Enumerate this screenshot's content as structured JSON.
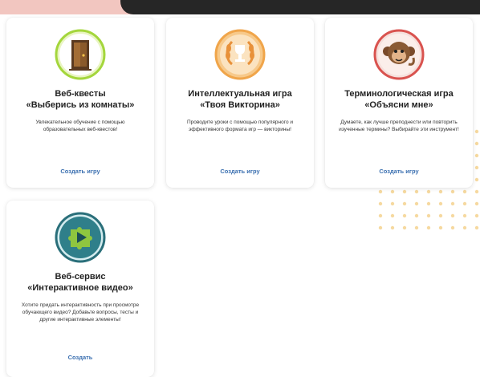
{
  "cards": [
    {
      "icon": "door-icon",
      "title_line1": "Веб-квесты",
      "title_line2": "«Выберись из комнаты»",
      "description": "Увлекательное обучение с помощью образовательных веб-квестов!",
      "link": "Создать игру"
    },
    {
      "icon": "laurel-trophy-icon",
      "title_line1": "Интеллектуальная игра",
      "title_line2": "«Твоя Викторина»",
      "description": "Проводите уроки с помощью популярного и эффективного формата игр — викторины!",
      "link": "Создать игру"
    },
    {
      "icon": "monkey-icon",
      "title_line1": "Терминологическая игра",
      "title_line2": "«Объясни мне»",
      "description": "Думаете, как лучше преподнести или повторить изученные термины? Выбирайте эти инструмент!",
      "link": "Создать игру"
    },
    {
      "icon": "video-puzzle-icon",
      "title_line1": "Веб-сервис",
      "title_line2": "«Интерактивное видео»",
      "description": "Хотите придать интерактивность при просмотре обучающего видео? Добавьте вопросы, тесты и другие интерактивные элементы!",
      "link": "Создать"
    }
  ],
  "colors": {
    "link": "#3a6fb0",
    "accent_dots": "#f6d9a0",
    "top_band_pink": "#f2c6c0",
    "top_band_dark": "#262626"
  }
}
